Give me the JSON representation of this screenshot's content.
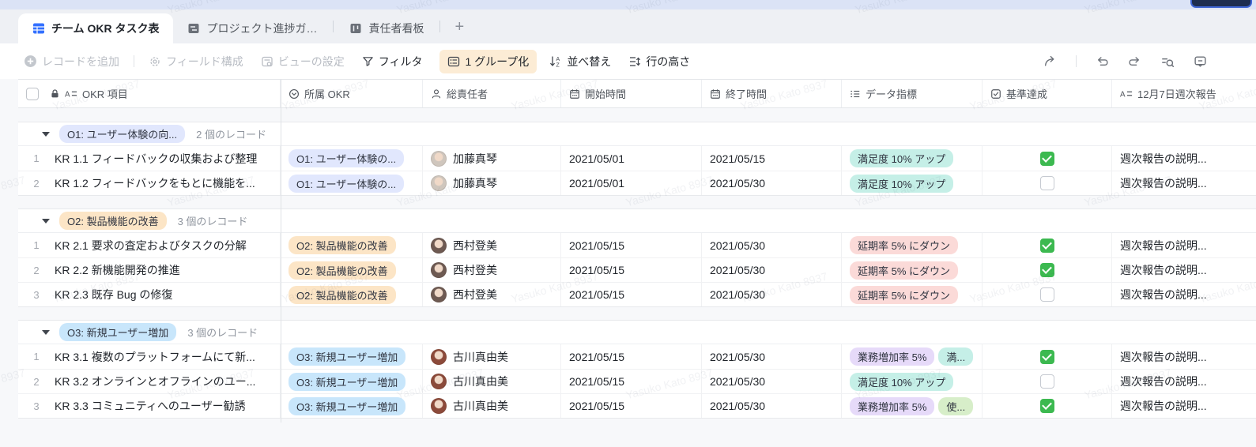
{
  "watermark": "Yasuko Kato 8937",
  "palette": {
    "accent_blue": "#3370ff",
    "check_green": "#3cb950",
    "toolbar_group_bg": "#fcecd5",
    "topstrip": "#dbe3f6",
    "corner_button": "#1d2d50",
    "tag_lavender": "#e1e7fd",
    "tag_peach": "#fce5c6",
    "tag_blue": "#c8e6fb",
    "tag_teal": "#c5efe7",
    "tag_pink": "#fbdad8",
    "tag_purple": "#e6daf9",
    "tag_green": "#d7eec9"
  },
  "tabs": {
    "tab1": "チーム OKR タスク表",
    "tab2": "プロジェクト進捗ガ…",
    "tab3": "責任者看板",
    "add": "+"
  },
  "toolbar": {
    "add_record": "レコードを追加",
    "field_config": "フィールド構成",
    "view_settings": "ビューの設定",
    "filter": "フィルタ",
    "group": "1 グループ化",
    "sort": "並べ替え",
    "row_height": "行の高さ"
  },
  "columns": {
    "okr_item": "OKR 項目",
    "parent_okr": "所属 OKR",
    "owner": "総責任者",
    "start": "開始時間",
    "end": "終了時間",
    "metrics": "データ指標",
    "baseline": "基準達成",
    "weekly": "12月7日週次報告"
  },
  "groups": [
    {
      "pill": "O1: ユーザー体験の向...",
      "color": "lavender",
      "count": "2 個のレコード",
      "rows": [
        {
          "num": "1",
          "title": "KR 1.1 フィードバックの収集および整理",
          "tag": "O1: ユーザー体験の...",
          "tag_color": "lavender",
          "owner": "加藤真琴",
          "avatar": "#cfc6bd",
          "start": "2021/05/01",
          "end": "2021/05/15",
          "metrics": [
            {
              "label": "満足度 10% アップ",
              "color": "teal"
            }
          ],
          "checked": true,
          "report": "週次報告の説明..."
        },
        {
          "num": "2",
          "title": "KR 1.2 フィードバックをもとに機能を...",
          "tag": "O1: ユーザー体験の...",
          "tag_color": "lavender",
          "owner": "加藤真琴",
          "avatar": "#cfc6bd",
          "start": "2021/05/01",
          "end": "2021/05/30",
          "metrics": [
            {
              "label": "満足度 10% アップ",
              "color": "teal"
            }
          ],
          "checked": false,
          "report": "週次報告の説明..."
        }
      ]
    },
    {
      "pill": "O2: 製品機能の改善",
      "color": "peach",
      "count": "3 個のレコード",
      "rows": [
        {
          "num": "1",
          "title": "KR 2.1 要求の査定およびタスクの分解",
          "tag": "O2: 製品機能の改善",
          "tag_color": "peach",
          "owner": "西村登美",
          "avatar": "#6e5a52",
          "start": "2021/05/15",
          "end": "2021/05/30",
          "metrics": [
            {
              "label": "延期率 5% にダウン",
              "color": "pink"
            }
          ],
          "checked": true,
          "report": "週次報告の説明..."
        },
        {
          "num": "2",
          "title": "KR 2.2 新機能開発の推進",
          "tag": "O2: 製品機能の改善",
          "tag_color": "peach",
          "owner": "西村登美",
          "avatar": "#6e5a52",
          "start": "2021/05/15",
          "end": "2021/05/30",
          "metrics": [
            {
              "label": "延期率 5% にダウン",
              "color": "pink"
            }
          ],
          "checked": true,
          "report": "週次報告の説明..."
        },
        {
          "num": "3",
          "title": "KR 2.3 既存 Bug の修復",
          "tag": "O2: 製品機能の改善",
          "tag_color": "peach",
          "owner": "西村登美",
          "avatar": "#6e5a52",
          "start": "2021/05/15",
          "end": "2021/05/30",
          "metrics": [
            {
              "label": "延期率 5% にダウン",
              "color": "pink"
            }
          ],
          "checked": false,
          "report": "週次報告の説明..."
        }
      ]
    },
    {
      "pill": "O3: 新規ユーザー増加",
      "color": "blue",
      "count": "3 個のレコード",
      "rows": [
        {
          "num": "1",
          "title": "KR 3.1 複数のプラットフォームにて新...",
          "tag": "O3: 新規ユーザー増加",
          "tag_color": "blue",
          "owner": "古川真由美",
          "avatar": "#8c4a3a",
          "start": "2021/05/15",
          "end": "2021/05/30",
          "metrics": [
            {
              "label": "業務増加率 5%",
              "color": "purple"
            },
            {
              "label": "満...",
              "color": "teal"
            }
          ],
          "checked": true,
          "report": "週次報告の説明..."
        },
        {
          "num": "2",
          "title": "KR 3.2 オンラインとオフラインのユー...",
          "tag": "O3: 新規ユーザー増加",
          "tag_color": "blue",
          "owner": "古川真由美",
          "avatar": "#8c4a3a",
          "start": "2021/05/15",
          "end": "2021/05/30",
          "metrics": [
            {
              "label": "満足度 10% アップ",
              "color": "teal"
            }
          ],
          "checked": false,
          "report": "週次報告の説明..."
        },
        {
          "num": "3",
          "title": "KR 3.3 コミュニティへのユーザー勧誘",
          "tag": "O3: 新規ユーザー増加",
          "tag_color": "blue",
          "owner": "古川真由美",
          "avatar": "#8c4a3a",
          "start": "2021/05/15",
          "end": "2021/05/30",
          "metrics": [
            {
              "label": "業務増加率 5%",
              "color": "purple"
            },
            {
              "label": "使...",
              "color": "green"
            }
          ],
          "checked": true,
          "report": "週次報告の説明..."
        }
      ]
    }
  ]
}
